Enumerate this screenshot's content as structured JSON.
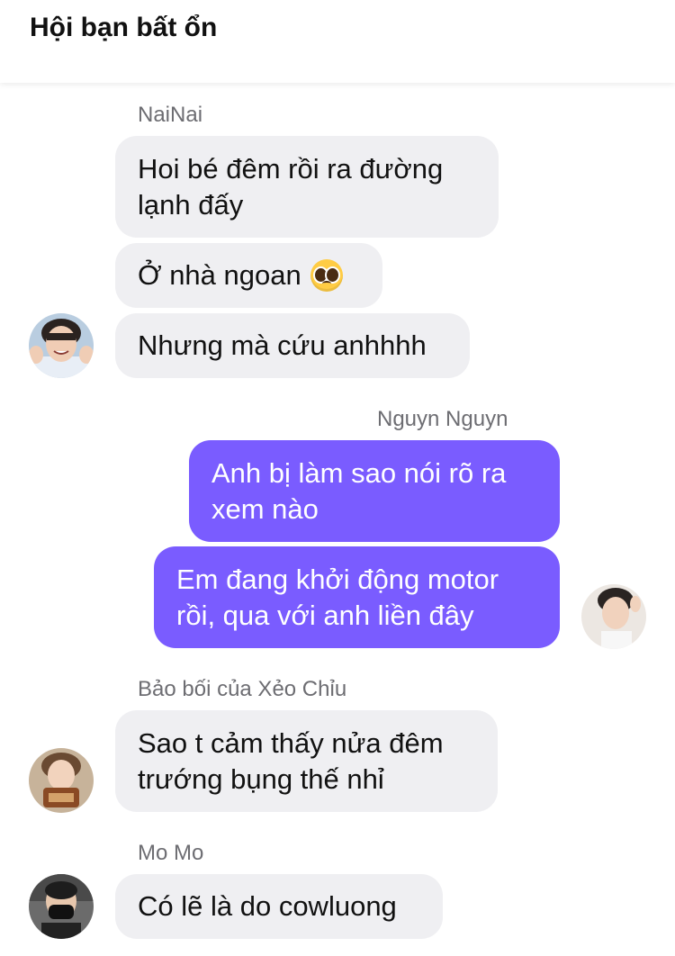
{
  "header": {
    "title": "Hội bạn bất ổn"
  },
  "messages": [
    {
      "sender": "NaiNai",
      "bubbles": [
        "Hoi bé đêm rồi ra đường lạnh đấy",
        "Ở nhà ngoan",
        "Nhưng mà cứu anhhhh"
      ]
    },
    {
      "sender": "Nguyn Nguyn",
      "bubbles": [
        "Anh bị làm sao nói rõ ra xem nào",
        "Em đang khởi động motor rồi, qua với anh liền đây"
      ]
    },
    {
      "sender": "Bảo bối của Xẻo Chỉu",
      "bubbles": [
        "Sao t cảm thấy nửa đêm trướng bụng thế nhỉ"
      ]
    },
    {
      "sender": "Mo Mo",
      "bubbles": [
        "Có lẽ là do cowluong"
      ]
    }
  ],
  "emoji": {
    "name": "pleading-face-icon"
  },
  "colors": {
    "outgoing": "#7a5cff",
    "incoming": "#efeff2"
  }
}
